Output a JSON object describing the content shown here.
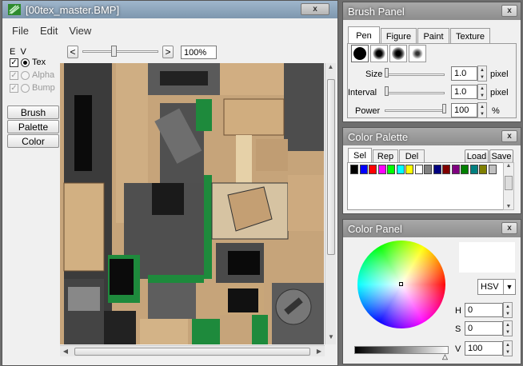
{
  "main_window": {
    "title": "[00tex_master.BMP]",
    "menu": [
      "File",
      "Edit",
      "View"
    ],
    "layer_header": {
      "e": "E",
      "v": "V"
    },
    "layers": [
      {
        "label": "Tex",
        "checked": true,
        "enabled": true
      },
      {
        "label": "Alpha",
        "checked": true,
        "enabled": false
      },
      {
        "label": "Bump",
        "checked": true,
        "enabled": false
      }
    ],
    "tool_buttons": [
      "Brush",
      "Palette",
      "Color"
    ],
    "zoom_left": "<",
    "zoom_right": ">",
    "zoom_value": "100%"
  },
  "brush_panel": {
    "title": "Brush Panel",
    "tabs": [
      "Pen",
      "Figure",
      "Paint",
      "Texture"
    ],
    "size": {
      "label": "Size",
      "value": "1.0",
      "unit": "pixel",
      "level": 0.0
    },
    "interval": {
      "label": "Interval",
      "value": "1.0",
      "unit": "pixel",
      "level": 0.0
    },
    "power": {
      "label": "Power",
      "value": "100",
      "unit": "%",
      "level": 1.0
    }
  },
  "color_palette": {
    "title": "Color Palette",
    "tabs": [
      "Sel",
      "Rep",
      "Del"
    ],
    "load": "Load",
    "save": "Save",
    "swatches": [
      "#000000",
      "#0000ff",
      "#ff0000",
      "#ff00ff",
      "#00ff00",
      "#00ffff",
      "#ffff00",
      "#ffffff",
      "#808080",
      "#000080",
      "#800000",
      "#800080",
      "#008000",
      "#008080",
      "#808000",
      "#c0c0c0"
    ]
  },
  "color_panel": {
    "title": "Color Panel",
    "mode": "HSV",
    "h": {
      "label": "H",
      "value": "0"
    },
    "s": {
      "label": "S",
      "value": "0"
    },
    "v": {
      "label": "V",
      "value": "100"
    },
    "current_color": "#ffffff"
  },
  "close_glyph": "x"
}
